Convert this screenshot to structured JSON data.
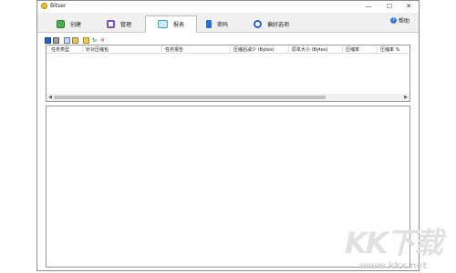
{
  "window": {
    "title": "Bitser",
    "controls": {
      "minimize": "—",
      "maximize": "☐",
      "close": "✕"
    }
  },
  "tabs": [
    {
      "label": "创建",
      "icon": "create-icon",
      "color": "#4caf50"
    },
    {
      "label": "管理",
      "icon": "manage-icon",
      "color": "#7a4fc6"
    },
    {
      "label": "报表",
      "icon": "report-icon",
      "color": "#3aa6d8",
      "active": true
    },
    {
      "label": "密码",
      "icon": "key-icon",
      "color": "#2f6fd0"
    },
    {
      "label": "偏好选项",
      "icon": "preferences-icon",
      "color": "#2a62c9"
    }
  ],
  "help": {
    "label": "帮助",
    "icon": "help-icon"
  },
  "toolbar": [
    {
      "name": "save-icon"
    },
    {
      "name": "print-icon"
    },
    {
      "name": "copy-icon"
    },
    {
      "name": "paste-icon"
    },
    {
      "name": "open-folder-icon"
    },
    {
      "name": "refresh-icon"
    },
    {
      "name": "delete-icon"
    }
  ],
  "table": {
    "columns": [
      "任务类型",
      "针对压缩包",
      "任务报告",
      "压缩后减少 (Bytes)",
      "原本大小 (Bytes)",
      "压缩率",
      "压缩率 %"
    ]
  },
  "watermark": {
    "logo": "KK下载",
    "url": "www.kkx.net"
  }
}
